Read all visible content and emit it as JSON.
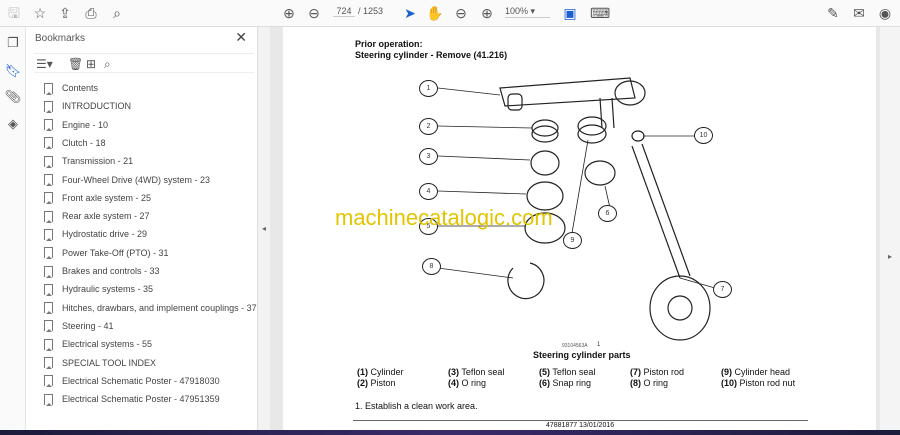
{
  "toolbar": {
    "page_current": "724",
    "page_total": "/ 1253",
    "zoom": "100%"
  },
  "bookmarks": {
    "title": "Bookmarks",
    "items": [
      "Contents",
      "INTRODUCTION",
      "Engine - 10",
      "Clutch - 18",
      "Transmission - 21",
      "Four-Wheel Drive (4WD) system - 23",
      "Front axle system - 25",
      "Rear axle system - 27",
      "Hydrostatic drive - 29",
      "Power Take-Off (PTO) - 31",
      "Brakes and controls - 33",
      "Hydraulic systems - 35",
      "Hitches, drawbars, and implement couplings - 37",
      "Steering - 41",
      "Electrical systems - 55",
      "SPECIAL TOOL INDEX",
      "Electrical Schematic Poster - 47918030",
      "Electrical Schematic Poster - 47951359"
    ]
  },
  "doc": {
    "prior_label": "Prior operation:",
    "prior_value": "Steering cylinder - Remove (41.216)",
    "watermark": "machinecatalogic.com",
    "fig_code": "93104563A",
    "fig_num": "1",
    "caption": "Steering cylinder parts",
    "callouts": [
      "1",
      "2",
      "3",
      "4",
      "5",
      "6",
      "7",
      "8",
      "9",
      "10",
      "8"
    ],
    "parts": [
      [
        "(1)",
        "Cylinder"
      ],
      [
        "(2)",
        "Piston"
      ],
      [
        "(3)",
        "Teflon seal"
      ],
      [
        "(4)",
        "O ring"
      ],
      [
        "(5)",
        "Teflon seal"
      ],
      [
        "(6)",
        "Snap ring"
      ],
      [
        "(7)",
        "Piston rod"
      ],
      [
        "(8)",
        "O ring"
      ],
      [
        "(9)",
        "Cylinder head"
      ],
      [
        "(10)",
        "Piston rod nut"
      ]
    ],
    "step": "1.   Establish a clean work area.",
    "footer": "47881877 13/01/2016"
  }
}
